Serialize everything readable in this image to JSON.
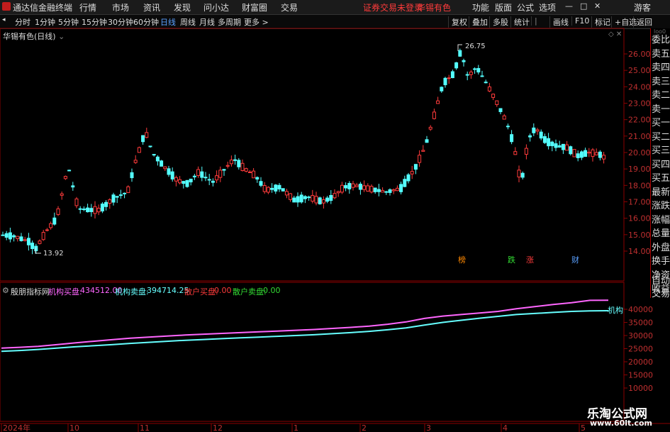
{
  "app": {
    "title": "通达信金融终端"
  },
  "menu": {
    "items": [
      "行情",
      "市场",
      "资讯",
      "发现",
      "问小达",
      "财富圈",
      "交易"
    ],
    "status": "证券交易未登录",
    "stock": "华锡有色",
    "right": [
      "功能",
      "版面",
      "公式",
      "选项"
    ],
    "guest": "游客"
  },
  "toolbar": {
    "periods": [
      "分时",
      "1分钟",
      "5分钟",
      "15分钟",
      "30分钟",
      "60分钟",
      "日线",
      "周线",
      "月线",
      "多周期",
      "更多 >"
    ],
    "active": "日线",
    "right": [
      "复权",
      "叠加",
      "多股",
      "统计",
      "画线",
      "F10",
      "标记",
      "+自选",
      "返回"
    ]
  },
  "chart": {
    "stock_label": "华锡有色(日线)",
    "high_label": "26.75",
    "low_label": "13.92",
    "price_ticks": [
      "26.00",
      "25.00",
      "24.00",
      "23.00",
      "22.00",
      "21.00",
      "20.00",
      "19.00",
      "18.00",
      "17.00",
      "16.00",
      "15.00",
      "14.00"
    ],
    "markers": [
      {
        "label": "榜",
        "color": "#ff8800"
      },
      {
        "label": "跌",
        "color": "#33dd33"
      },
      {
        "label": "涨",
        "color": "#ff3b3b"
      },
      {
        "label": "财",
        "color": "#5aa0ff"
      }
    ],
    "side_panel": [
      "委比",
      "卖五",
      "卖四",
      "卖三",
      "卖二",
      "卖一",
      "买一",
      "买二",
      "买三",
      "买四",
      "买五",
      "最新",
      "涨跌",
      "涨幅",
      "总量",
      "外盘",
      "换手",
      "净资",
      "收益"
    ],
    "side_bottom": [
      "自动",
      "交易"
    ]
  },
  "indicator": {
    "name": "殷朋指标网",
    "inst_buy_label": "机构买盘:",
    "inst_buy_value": "434512.00",
    "inst_sell_label": "机构卖盘:",
    "inst_sell_value": "394714.25",
    "retail_buy_label": "散户买盘:",
    "retail_buy_value": "0.00",
    "retail_sell_label": "散户卖盘:",
    "retail_sell_value": "0.00",
    "end_label": "机构",
    "y_ticks": [
      "40000",
      "35000",
      "30000",
      "25000",
      "20000",
      "15000",
      "10000"
    ],
    "buy_color": "#ff66ff",
    "sell_color": "#66ffff"
  },
  "xaxis": {
    "labels": [
      "2024年",
      "10",
      "11",
      "12",
      "1",
      "2",
      "3",
      "4",
      "5"
    ]
  },
  "brand": {
    "name": "乐淘公式网",
    "url": "www.60lt.com"
  },
  "chart_data": {
    "type": "line",
    "series": [
      {
        "name": "机构买盘",
        "values": [
          25200,
          25500,
          25900,
          26500,
          27200,
          27800,
          28400,
          29000,
          29400,
          29800,
          30200,
          30500,
          30800,
          31100,
          31400,
          31700,
          32000,
          32300,
          32700,
          33100,
          33600,
          34300,
          35200,
          36500,
          37400,
          38000,
          38600,
          39200,
          40200,
          41000,
          41800,
          42500,
          43400,
          43451
        ]
      },
      {
        "name": "机构卖盘",
        "values": [
          24000,
          24300,
          24700,
          25200,
          25700,
          26100,
          26500,
          27000,
          27400,
          27800,
          28200,
          28500,
          28800,
          29100,
          29400,
          29700,
          30000,
          30300,
          30700,
          31100,
          31600,
          32200,
          32900,
          34000,
          35000,
          35800,
          36600,
          37300,
          38000,
          38400,
          38800,
          39200,
          39400,
          39471
        ]
      }
    ],
    "ylim": [
      8000,
      45000
    ]
  }
}
